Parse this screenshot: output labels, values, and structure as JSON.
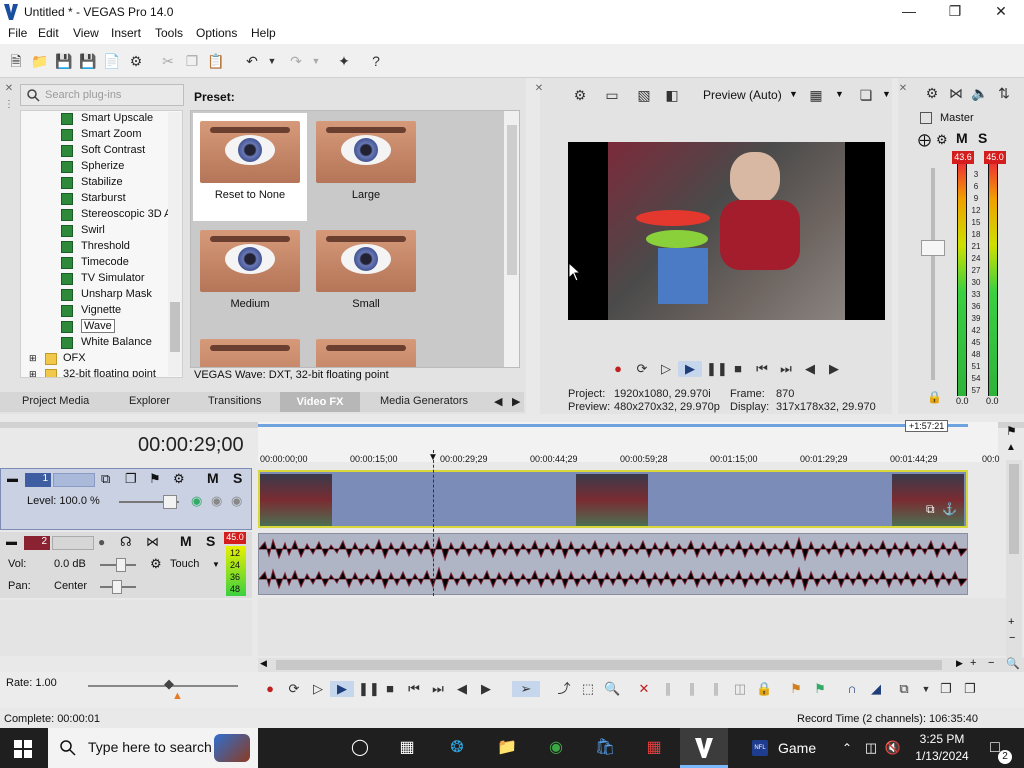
{
  "window": {
    "title": "Untitled * - VEGAS Pro 14.0",
    "minimize": "—",
    "maximize": "❐",
    "close": "✕"
  },
  "menu": [
    "File",
    "Edit",
    "View",
    "Insert",
    "Tools",
    "Options",
    "Help"
  ],
  "plugins": {
    "search_placeholder": "Search plug-ins",
    "items": [
      "Smart Upscale",
      "Smart Zoom",
      "Soft Contrast",
      "Spherize",
      "Stabilize",
      "Starburst",
      "Stereoscopic 3D A",
      "Swirl",
      "Threshold",
      "Timecode",
      "TV Simulator",
      "Unsharp Mask",
      "Vignette",
      "Wave",
      "White Balance"
    ],
    "folder_ofx": "OFX",
    "folder_partial": "32-bit floating point"
  },
  "preset": {
    "heading": "Preset:",
    "items": [
      "Reset to None",
      "Large",
      "Medium",
      "Small"
    ],
    "caption": "VEGAS Wave: DXT, 32-bit floating point"
  },
  "tabs": [
    "Project Media",
    "Explorer",
    "Transitions",
    "Video FX",
    "Media Generators"
  ],
  "preview": {
    "mode": "Preview (Auto)",
    "project_label": "Project:",
    "project_value": "1920x1080, 29.970i",
    "preview_label": "Preview:",
    "preview_value": "480x270x32, 29.970p",
    "frame_label": "Frame:",
    "frame_value": "870",
    "display_label": "Display:",
    "display_value": "317x178x32, 29.970"
  },
  "mixer": {
    "label": "Master",
    "M": "M",
    "S": "S",
    "peak_left": "43.6",
    "peak_right": "45.0",
    "scale": [
      "3",
      "6",
      "9",
      "12",
      "15",
      "18",
      "21",
      "24",
      "27",
      "30",
      "33",
      "36",
      "39",
      "42",
      "45",
      "48",
      "51",
      "54",
      "57"
    ],
    "bottom_left": "0.0",
    "bottom_right": "0.0"
  },
  "timeline": {
    "timecode": "00:00:29;00",
    "duration_badge": "+1:57:21",
    "ruler": [
      "00:00:00;00",
      "00:00:15;00",
      "00:00:29;29",
      "00:00:44;29",
      "00:00:59;28",
      "00:01:15;00",
      "00:01:29;29",
      "00:01:44;29",
      "00:0"
    ],
    "video_track": {
      "num": "1",
      "level": "Level: 100.0 %",
      "M": "M",
      "S": "S"
    },
    "audio_track": {
      "num": "2",
      "vol_label": "Vol:",
      "vol_value": "0.0 dB",
      "pan_label": "Pan:",
      "pan_value": "Center",
      "touch": "Touch",
      "M": "M",
      "S": "S",
      "peak": "45.0",
      "meter_scale": [
        "12",
        "24",
        "36",
        "48"
      ]
    }
  },
  "transport": {
    "rate": "Rate: 1.00"
  },
  "status": {
    "complete": "Complete: 00:00:01",
    "record_time": "Record Time (2 channels): 106:35:40"
  },
  "taskbar": {
    "search_placeholder": "Type here to search",
    "game_label": "Game",
    "nfl": "NFL",
    "time": "3:25 PM",
    "date": "1/13/2024",
    "notifications": "2"
  }
}
